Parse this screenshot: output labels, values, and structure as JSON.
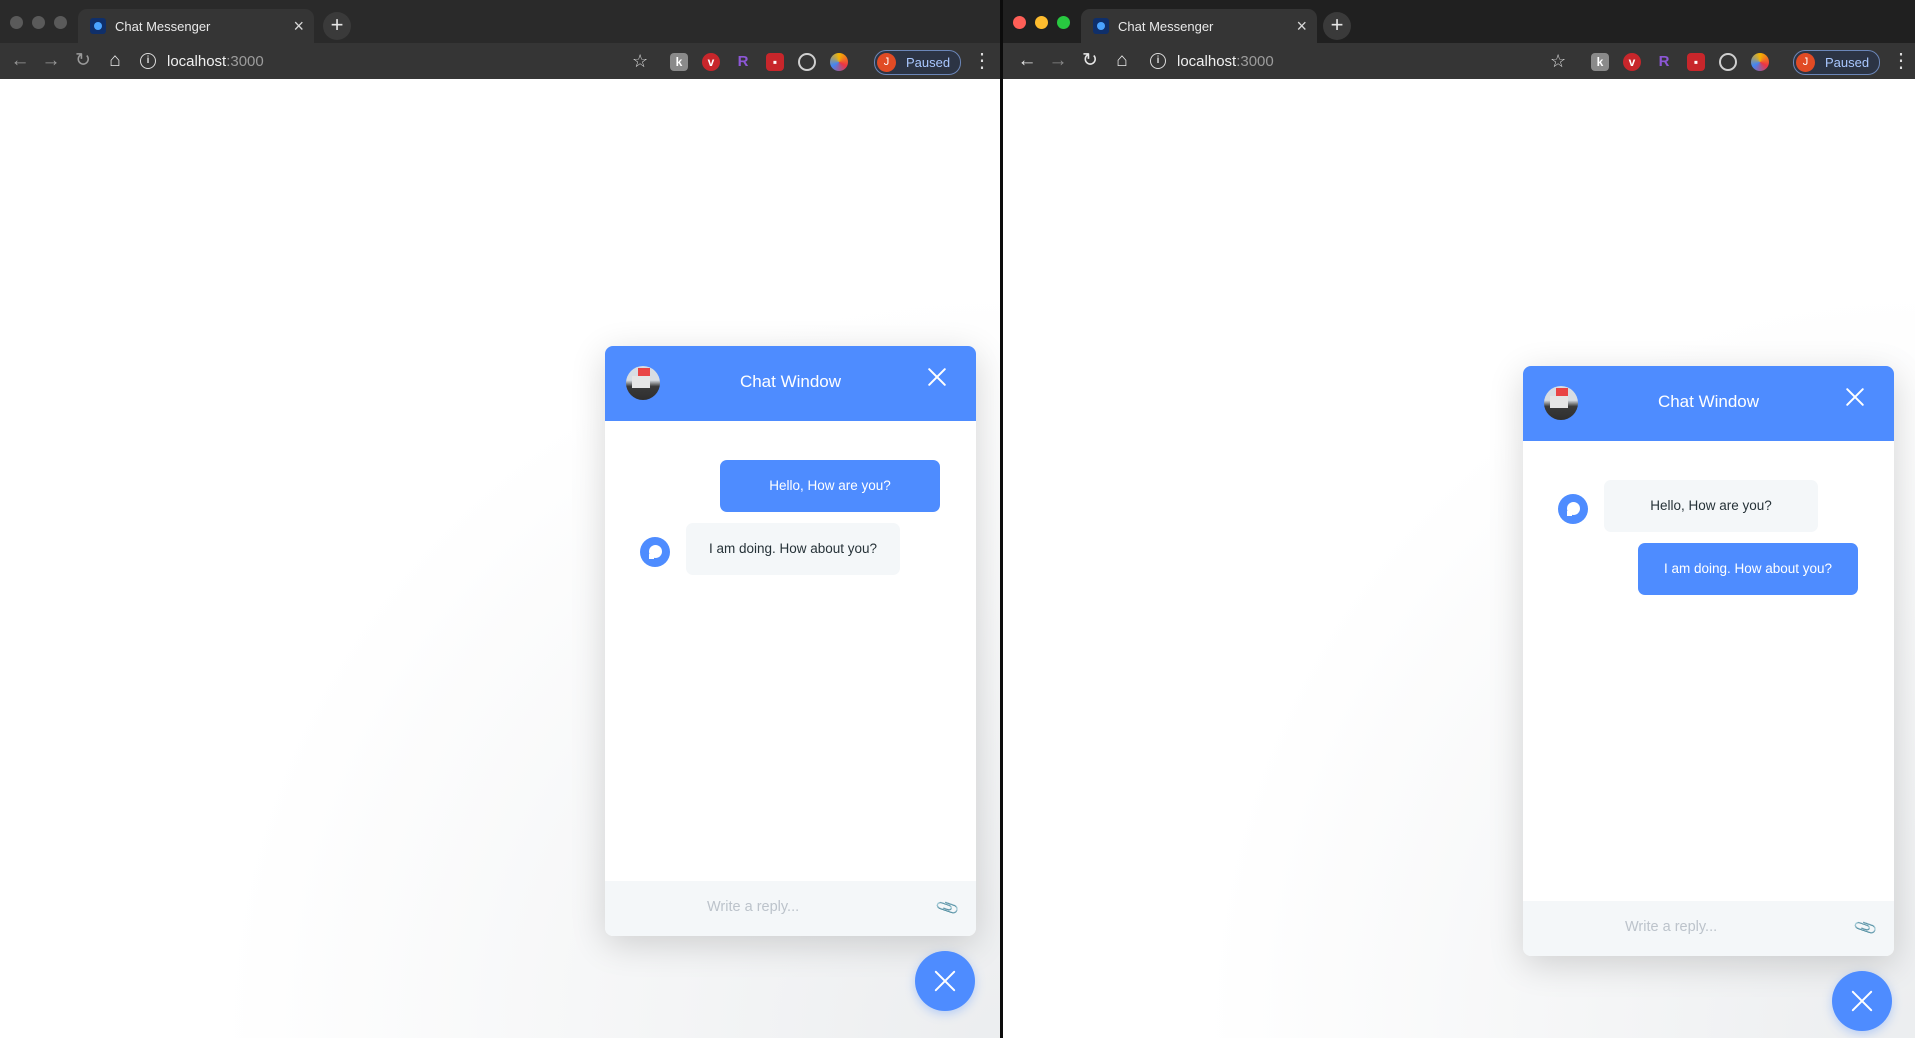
{
  "left_browser": {
    "tab_title": "Chat Messenger",
    "url_host": "localhost",
    "url_port": ":3000",
    "profile_initial": "J",
    "profile_status": "Paused",
    "chat": {
      "title": "Chat Window",
      "messages": [
        {
          "sender": "me",
          "text": "Hello, How are you?"
        },
        {
          "sender": "them",
          "text": "I am doing. How about you?"
        }
      ],
      "input_placeholder": "Write a reply..."
    }
  },
  "right_browser": {
    "tab_title": "Chat Messenger",
    "url_host": "localhost",
    "url_port": ":3000",
    "profile_initial": "J",
    "profile_status": "Paused",
    "chat": {
      "title": "Chat Window",
      "messages": [
        {
          "sender": "them",
          "text": "Hello, How are you?"
        },
        {
          "sender": "me",
          "text": "I am doing. How about you?"
        }
      ],
      "input_placeholder": "Write a reply..."
    }
  },
  "extensions": [
    "k-extension-icon",
    "vivaldi-extension-icon",
    "r-extension-icon",
    "gift-extension-icon",
    "target-extension-icon",
    "palette-extension-icon"
  ],
  "colors": {
    "accent": "#4e8cff",
    "bubble_received": "#f4f7f9",
    "text_dark": "#263238"
  }
}
